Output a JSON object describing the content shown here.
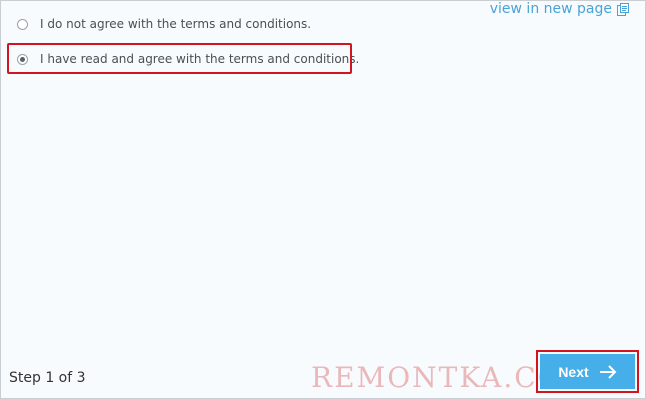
{
  "view_link": {
    "label": "view in new page",
    "icon": "external-page-icon"
  },
  "options": [
    {
      "label": "I do not agree with the terms and conditions.",
      "selected": false
    },
    {
      "label": "I have read and agree with the terms and conditions.",
      "selected": true
    }
  ],
  "footer": {
    "step_text": "Step 1 of 3",
    "next_label": "Next",
    "next_icon": "arrow-right-icon"
  },
  "watermark": "REMONTKA.COM",
  "colors": {
    "link": "#4aa3d6",
    "next_button": "#46aee8",
    "highlight": "#d1141d"
  }
}
